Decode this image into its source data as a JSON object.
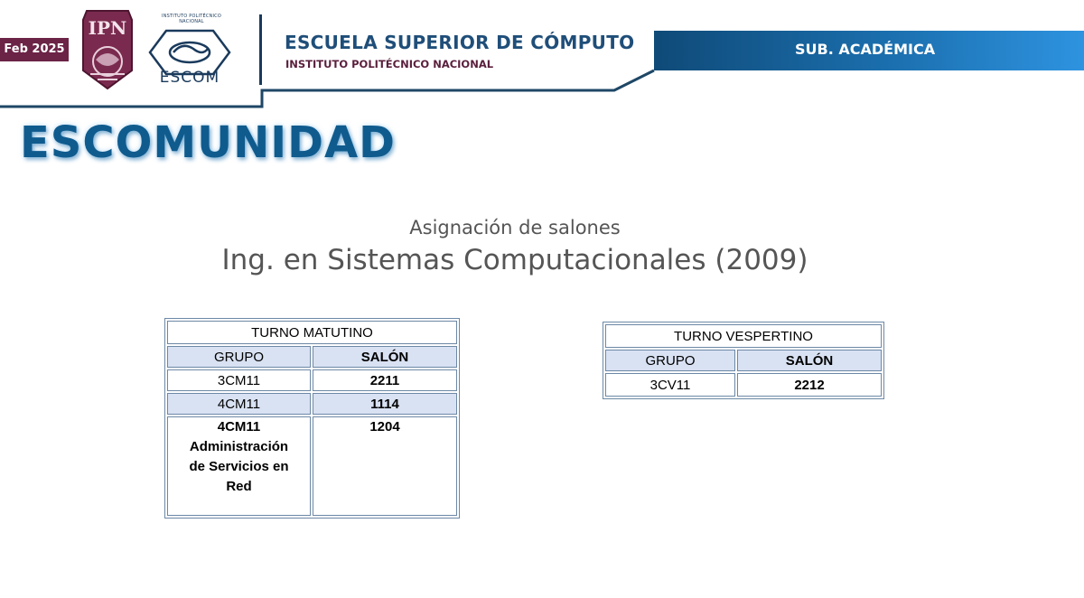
{
  "header": {
    "date_badge": "Feb 2025",
    "ipn_logo_text": "IPN",
    "escom_logo_small_text": "INSTITUTO POLITÉCNICO NACIONAL",
    "escom_logo_text": "ESCOM",
    "school_name": "ESCUELA SUPERIOR DE CÓMPUTO",
    "institute_name": "INSTITUTO POLITÉCNICO NACIONAL",
    "department": "SUB. ACADÉMICA"
  },
  "title": "ESCOMUNIDAD",
  "subtitle": "Asignación de salones",
  "career": "Ing. en Sistemas Computacionales (2009)",
  "tables": {
    "morning": {
      "title": "TURNO MATUTINO",
      "col_group": "GRUPO",
      "col_room": "SALÓN",
      "rows": [
        {
          "group": "3CM11",
          "room": "2211"
        },
        {
          "group": "4CM11",
          "room": "1114"
        },
        {
          "group": "4CM11",
          "group_detail": "Administración de Servicios en Red",
          "room": "1204"
        }
      ]
    },
    "evening": {
      "title": "TURNO VESPERTINO",
      "col_group": "GRUPO",
      "col_room": "SALÓN",
      "rows": [
        {
          "group": "3CV11",
          "room": "2212"
        }
      ]
    }
  },
  "colors": {
    "brand_blue": "#1f4e79",
    "brand_guinda": "#6b2346",
    "header_band_start": "#0f4a78",
    "header_band_end": "#2b8ad6",
    "table_row_fill": "#d9e2f3",
    "table_border": "#6c88a6"
  }
}
